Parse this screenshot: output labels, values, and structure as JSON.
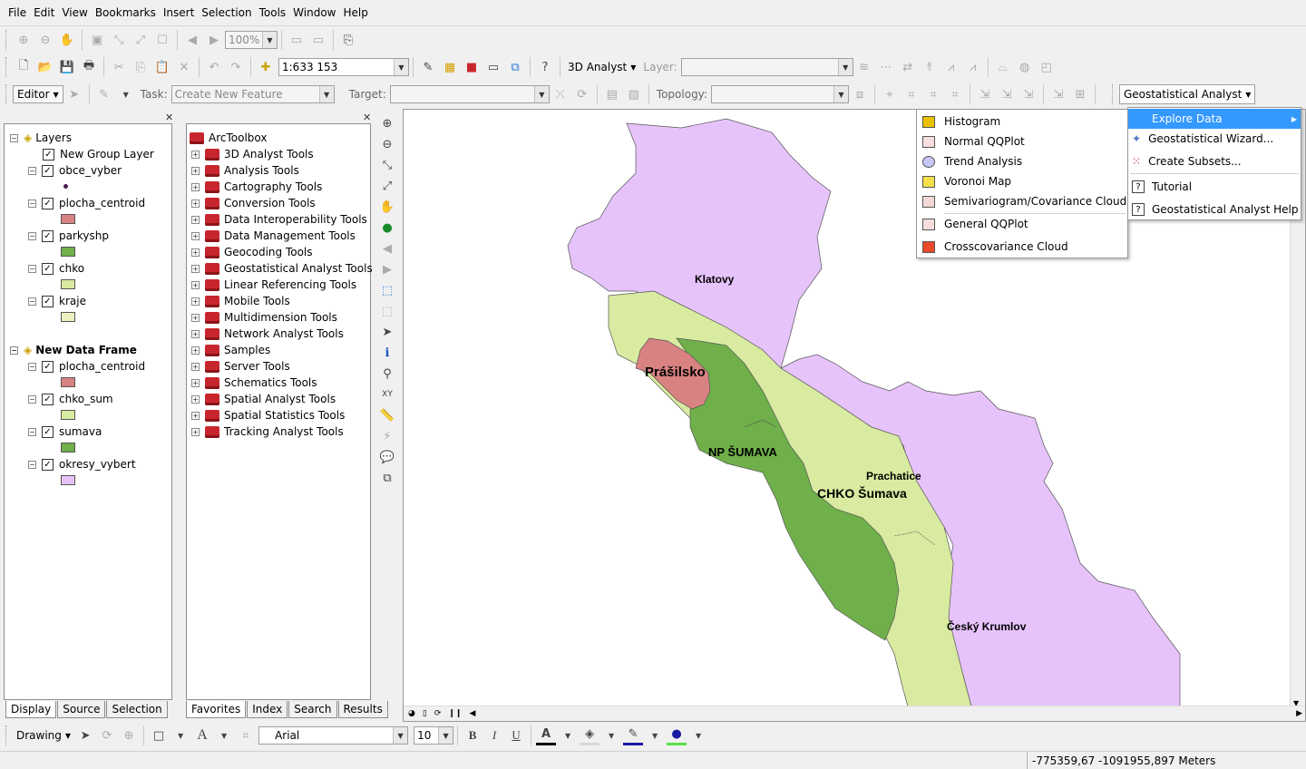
{
  "menubar": [
    "File",
    "Edit",
    "View",
    "Bookmarks",
    "Insert",
    "Selection",
    "Tools",
    "Window",
    "Help"
  ],
  "toolbar1": {
    "zoom_percent": "100%"
  },
  "toolbar2": {
    "scale": "1:633 153",
    "analyst3d_label": "3D Analyst",
    "layer_label": "Layer:",
    "geostat_label": "Geostatistical Analyst"
  },
  "toolbar3": {
    "editor_label": "Editor",
    "task_label": "Task:",
    "task_value": "Create New Feature",
    "target_label": "Target:",
    "topology_label": "Topology:"
  },
  "toc": {
    "root": "Layers",
    "frame2": "New Data Frame",
    "layers1": [
      "New Group Layer",
      "obce_vyber",
      "plocha_centroid",
      "parkyshp",
      "chko",
      "kraje"
    ],
    "layers2": [
      "plocha_centroid",
      "chko_sum",
      "sumava",
      "okresy_vybert"
    ],
    "tabs": [
      "Display",
      "Source",
      "Selection"
    ]
  },
  "toolbox": {
    "root": "ArcToolbox",
    "items": [
      "3D Analyst Tools",
      "Analysis Tools",
      "Cartography Tools",
      "Conversion Tools",
      "Data Interoperability Tools",
      "Data Management Tools",
      "Geocoding Tools",
      "Geostatistical Analyst Tools",
      "Linear Referencing Tools",
      "Mobile Tools",
      "Multidimension Tools",
      "Network Analyst Tools",
      "Samples",
      "Server Tools",
      "Schematics Tools",
      "Spatial Analyst Tools",
      "Spatial Statistics Tools",
      "Tracking Analyst Tools"
    ],
    "tabs": [
      "Favorites",
      "Index",
      "Search",
      "Results"
    ]
  },
  "map_labels": {
    "klatovy": "Klatovy",
    "prasilsko": "Prášilsko",
    "np_sumava": "NP ŠUMAVA",
    "prachatice": "Prachatice",
    "chko_sumava": "CHKO Šumava",
    "cesky_krumlov": "Český Krumlov"
  },
  "geostat_menu": [
    "Explore Data",
    "Geostatistical Wizard...",
    "Create Subsets...",
    "Tutorial",
    "Geostatistical Analyst Help"
  ],
  "explore_submenu": [
    "Histogram",
    "Normal QQPlot",
    "Trend Analysis",
    "Voronoi Map",
    "Semivariogram/Covariance Cloud",
    "General QQPlot",
    "Crosscovariance Cloud"
  ],
  "drawing": {
    "label": "Drawing",
    "font": "Arial",
    "size": "10"
  },
  "status": {
    "coords": "-775359,67  -1091955,897 Meters"
  },
  "colors": {
    "klatovy": "#e6c3fa",
    "chko": "#d9eba0",
    "np": "#6fb04a",
    "prasilsko": "#d98282"
  }
}
